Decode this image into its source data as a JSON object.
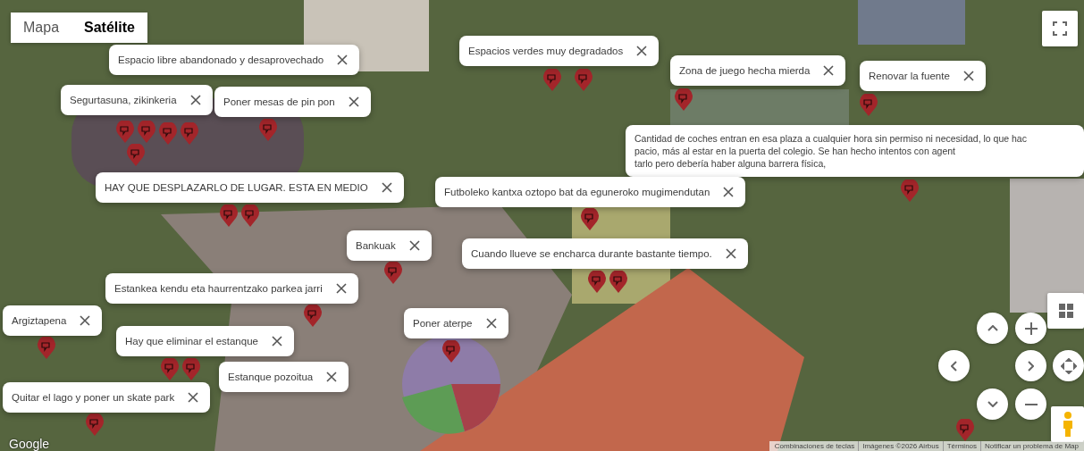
{
  "map_type_control": [
    {
      "label": "Mapa",
      "selected": false
    },
    {
      "label": "Satélite",
      "selected": true
    }
  ],
  "comments": [
    {
      "text": "Espacio libre abandonado y desaprovechado"
    },
    {
      "text": "Segurtasuna, zikinkeria"
    },
    {
      "text": "Poner mesas de pin pon"
    },
    {
      "text": "Espacios verdes muy degradados"
    },
    {
      "text": "Zona de juego hecha mierda"
    },
    {
      "text": "Renovar la fuente"
    },
    {
      "lines": [
        "Cantidad de coches entran en esa plaza a cualquier hora sin permiso ni necesidad, lo que hac",
        "pacio, más al estar en la puerta del colegio. Se han hecho intentos con agent",
        "tarlo pero debería haber alguna barrera física,"
      ]
    },
    {
      "text": "Futboleko kantxa oztopo bat da eguneroko mugimendutan"
    },
    {
      "text": "HAY QUE DESPLAZARLO DE LUGAR. ESTA EN MEDIO"
    },
    {
      "text": "Bankuak"
    },
    {
      "text": "Cuando llueve se encharca durante bastante tiempo."
    },
    {
      "text": "Estankea kendu eta haurrentzako parkea jarri"
    },
    {
      "text": "Argiztapena"
    },
    {
      "text": "Poner aterpe"
    },
    {
      "text": "Hay que eliminar el estanque"
    },
    {
      "text": "Estanque pozoitua"
    },
    {
      "text": "Quitar el lago y poner un skate park"
    }
  ],
  "logo": "Google",
  "attribution": [
    "Combinaciones de teclas",
    "Imágenes ©2026 Airbus",
    "Términos",
    "Notificar un problema de Map"
  ]
}
